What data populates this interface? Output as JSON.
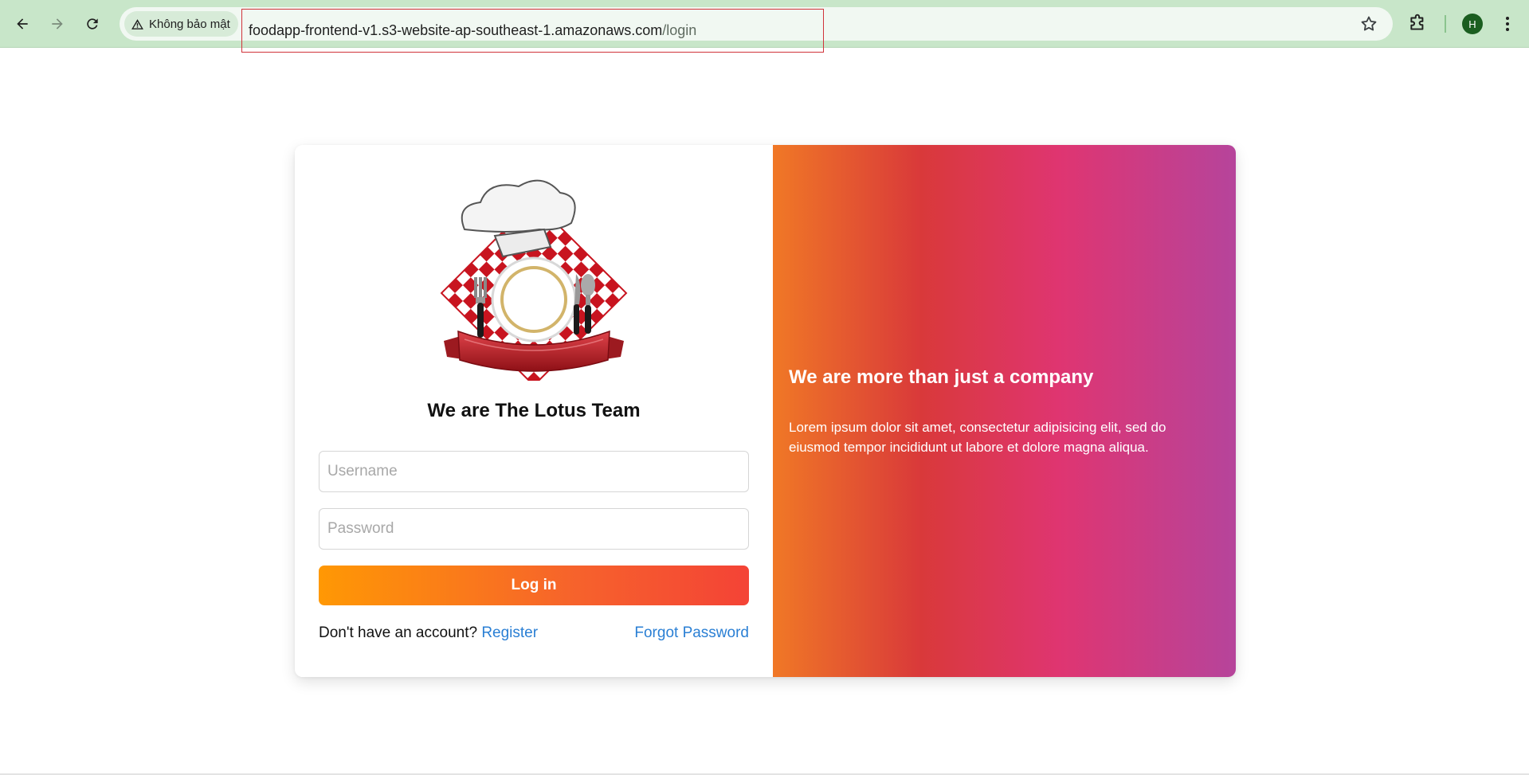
{
  "browser": {
    "security_label": "Không bảo mật",
    "url_host": "foodapp-frontend-v1.s3-website-ap-southeast-1.amazonaws.com",
    "url_path": "/login",
    "profile_initial": "H",
    "theme_color": "#c8e6c9"
  },
  "login": {
    "logo_icon": "chef-hat-plate-logo",
    "title": "We are The Lotus Team",
    "username_placeholder": "Username",
    "password_placeholder": "Password",
    "login_label": "Log in",
    "no_account_text": "Don't have an account?",
    "register_label": "Register",
    "forgot_label": "Forgot Password",
    "link_color": "#2a7fd4",
    "button_gradient": [
      "#ff9804",
      "#f44336"
    ]
  },
  "promo": {
    "title": "We are more than just a company",
    "body": "Lorem ipsum dolor sit amet, consectetur adipisicing elit, sed do eiusmod tempor incididunt ut labore et dolore magna aliqua.",
    "gradient": [
      "#f07826",
      "#d9393a",
      "#df3571",
      "#b6449b"
    ]
  }
}
